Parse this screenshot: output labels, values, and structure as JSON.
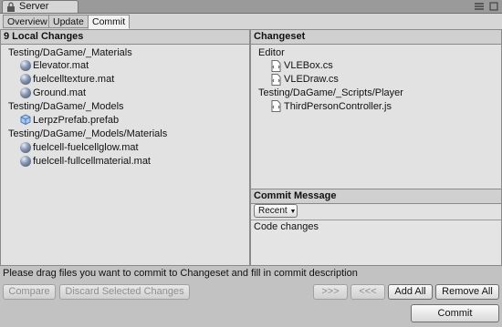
{
  "window": {
    "title": "Server"
  },
  "tabs": [
    {
      "label": "Overview"
    },
    {
      "label": "Update"
    },
    {
      "label": "Commit"
    }
  ],
  "local_changes": {
    "header": "9 Local Changes",
    "groups": [
      {
        "folder": "Testing/DaGame/_Materials",
        "files": [
          {
            "name": "Elevator.mat",
            "icon": "material-sphere-icon"
          },
          {
            "name": "fuelcelltexture.mat",
            "icon": "material-sphere-icon"
          },
          {
            "name": "Ground.mat",
            "icon": "material-sphere-icon"
          }
        ]
      },
      {
        "folder": "Testing/DaGame/_Models",
        "files": [
          {
            "name": "LerpzPrefab.prefab",
            "icon": "prefab-cube-icon"
          }
        ]
      },
      {
        "folder": "Testing/DaGame/_Models/Materials",
        "files": [
          {
            "name": "fuelcell-fuelcellglow.mat",
            "icon": "material-sphere-icon"
          },
          {
            "name": "fuelcell-fullcellmaterial.mat",
            "icon": "material-sphere-icon"
          }
        ]
      }
    ]
  },
  "changeset": {
    "header": "Changeset",
    "groups": [
      {
        "folder": "Editor",
        "files": [
          {
            "name": "VLEBox.cs",
            "icon": "script-file-icon"
          },
          {
            "name": "VLEDraw.cs",
            "icon": "script-file-icon"
          }
        ]
      },
      {
        "folder": "Testing/DaGame/_Scripts/Player",
        "files": [
          {
            "name": "ThirdPersonController.js",
            "icon": "script-file-icon"
          }
        ]
      }
    ]
  },
  "commit_message": {
    "header": "Commit Message",
    "recent_label": "Recent",
    "text": "Code changes"
  },
  "status": "Please drag files you want to commit to Changeset and fill in commit description",
  "buttons": {
    "compare": "Compare",
    "discard": "Discard Selected Changes",
    "move_right": ">>>",
    "move_left": "<<<",
    "add_all": "Add All",
    "remove_all": "Remove All",
    "commit": "Commit"
  }
}
